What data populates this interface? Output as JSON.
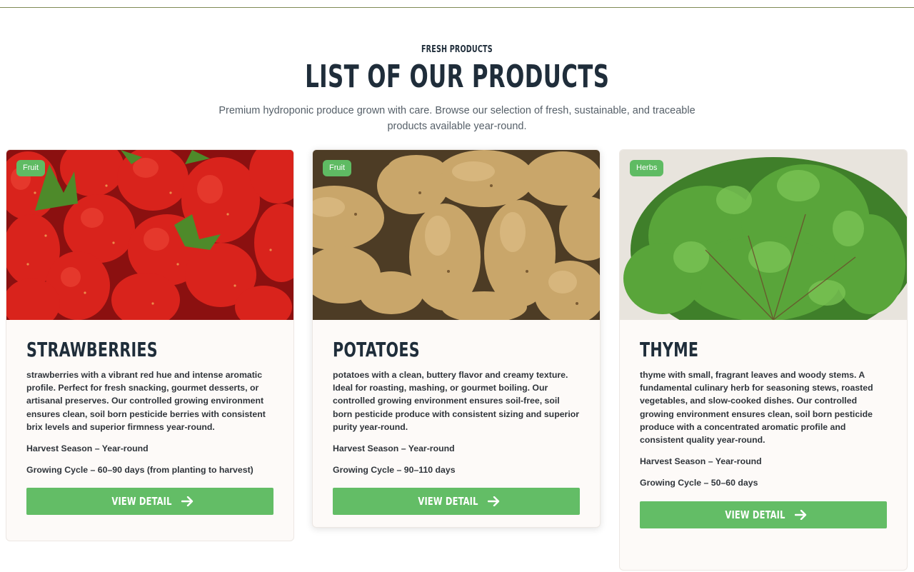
{
  "header": {
    "eyebrow": "FRESH PRODUCTS",
    "title": "LIST OF OUR PRODUCTS",
    "subtitle": "Premium hydroponic produce grown with care. Browse our selection of fresh, sustainable, and traceable products available year-round."
  },
  "colors": {
    "accent_green": "#63bd66",
    "heading": "#1f2d3a",
    "card_bg": "#fdfaf8"
  },
  "products": [
    {
      "badge": "Fruit",
      "name": "STRAWBERRIES",
      "description": "strawberries with a vibrant red hue and intense aromatic profile. Perfect for fresh snacking, gourmet desserts, or artisanal preserves. Our controlled growing environment ensures clean, soil born pesticide berries with consistent brix levels and superior firmness year-round.",
      "harvest": "Harvest Season – Year-round",
      "cycle": "Growing Cycle – 60–90 days (from planting to harvest)",
      "cta": "VIEW DETAIL",
      "image": "strawberries-photo"
    },
    {
      "badge": "Fruit",
      "name": "POTATOES",
      "description": "potatoes with a clean, buttery flavor and creamy texture. Ideal for roasting, mashing, or gourmet boiling. Our controlled growing environment ensures soil-free, soil born pesticide produce with consistent sizing and superior purity year-round.",
      "harvest": "Harvest Season – Year-round",
      "cycle": "Growing Cycle – 90–110 days",
      "cta": "VIEW DETAIL",
      "image": "potatoes-photo"
    },
    {
      "badge": "Herbs",
      "name": "THYME",
      "description": "thyme with small, fragrant leaves and woody stems. A fundamental culinary herb for seasoning stews, roasted vegetables, and slow-cooked dishes. Our controlled growing environment ensures clean, soil born pesticide produce with a concentrated aromatic profile and consistent quality year-round.",
      "harvest": "Harvest Season – Year-round",
      "cycle": "Growing Cycle – 50–60 days",
      "cta": "VIEW DETAIL",
      "image": "thyme-photo"
    }
  ]
}
